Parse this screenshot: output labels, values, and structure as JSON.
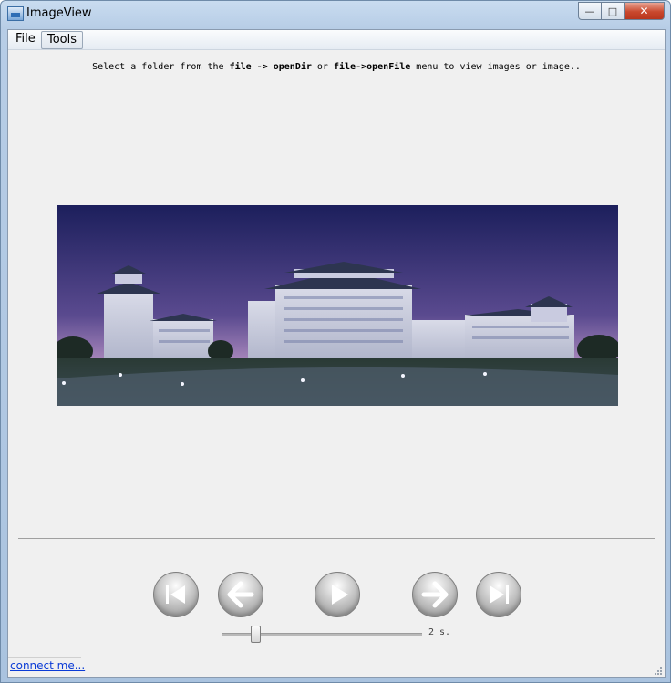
{
  "window": {
    "title": "ImageView",
    "close_glyph": "✕",
    "max_glyph": "□",
    "min_glyph": "—"
  },
  "menu": {
    "items": [
      {
        "label": "File"
      },
      {
        "label": "Tools"
      }
    ]
  },
  "hint": {
    "part1": "Select a folder from the ",
    "bold1": "file -> openDir",
    "part2": " or ",
    "bold2": "file->openFile",
    "part3": " menu to view images or image.."
  },
  "viewer": {
    "image_icon": "building-panorama-image"
  },
  "controls": {
    "icons": [
      "first-icon",
      "previous-icon",
      "play-icon",
      "next-icon",
      "last-icon"
    ]
  },
  "slideshow": {
    "interval_label": "2 s.",
    "interval_seconds": 2,
    "slider_fraction": 0.2
  },
  "status": {
    "link_text": "connect me..."
  }
}
